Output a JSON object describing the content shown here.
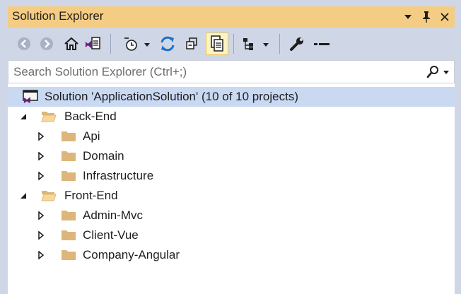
{
  "window": {
    "title": "Solution Explorer"
  },
  "search": {
    "placeholder": "Search Solution Explorer (Ctrl+;)"
  },
  "colors": {
    "title_bar": "#f5cc84",
    "chrome": "#cfd6e5",
    "selection": "#c9d9f2",
    "folder": "#dcb67a",
    "refresh": "#1e6fc9",
    "vs_purple": "#68217a"
  },
  "toolbar": {
    "buttons": [
      {
        "icon": "back-icon"
      },
      {
        "icon": "forward-icon"
      },
      {
        "icon": "home-icon"
      },
      {
        "icon": "switch-views-icon"
      },
      {
        "icon": "pending-changes-filter-icon"
      },
      {
        "icon": "refresh-icon"
      },
      {
        "icon": "collapse-all-icon"
      },
      {
        "icon": "show-all-files-icon",
        "active": true
      },
      {
        "icon": "view-class-diagram-icon"
      },
      {
        "icon": "properties-icon"
      },
      {
        "icon": "preview-selected-items-icon"
      }
    ]
  },
  "tree": {
    "solution": {
      "label": "Solution 'ApplicationSolution' (10 of 10 projects)"
    },
    "folders": [
      {
        "label": "Back-End",
        "expanded": true,
        "children": [
          {
            "label": "Api"
          },
          {
            "label": "Domain"
          },
          {
            "label": "Infrastructure"
          }
        ]
      },
      {
        "label": "Front-End",
        "expanded": true,
        "children": [
          {
            "label": "Admin-Mvc"
          },
          {
            "label": "Client-Vue"
          },
          {
            "label": "Company-Angular"
          }
        ]
      }
    ]
  }
}
